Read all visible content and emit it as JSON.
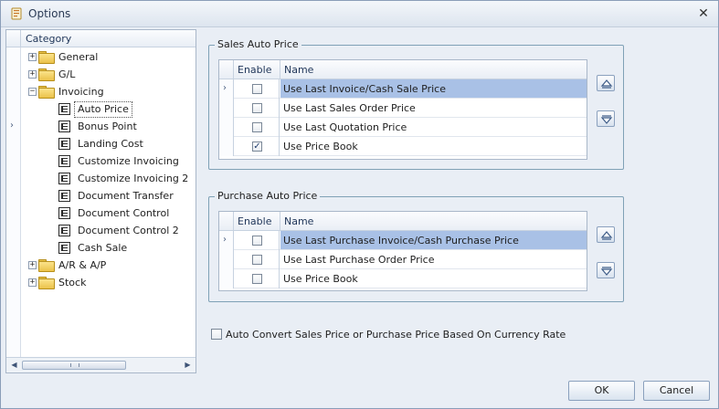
{
  "window": {
    "title": "Options",
    "close_glyph": "✕"
  },
  "tree": {
    "header": "Category",
    "items": [
      {
        "label": "General",
        "type": "folder",
        "level": 0,
        "expander": "+"
      },
      {
        "label": "G/L",
        "type": "folder",
        "level": 0,
        "expander": "+"
      },
      {
        "label": "Invoicing",
        "type": "folder",
        "level": 0,
        "expander": "−"
      },
      {
        "label": "Auto Price",
        "type": "page",
        "level": 1,
        "selected": true
      },
      {
        "label": "Bonus Point",
        "type": "page",
        "level": 1
      },
      {
        "label": "Landing Cost",
        "type": "page",
        "level": 1
      },
      {
        "label": "Customize Invoicing",
        "type": "page",
        "level": 1
      },
      {
        "label": "Customize Invoicing 2",
        "type": "page",
        "level": 1
      },
      {
        "label": "Document Transfer",
        "type": "page",
        "level": 1
      },
      {
        "label": "Document Control",
        "type": "page",
        "level": 1
      },
      {
        "label": "Document Control 2",
        "type": "page",
        "level": 1
      },
      {
        "label": "Cash Sale",
        "type": "page",
        "level": 1
      },
      {
        "label": "A/R & A/P",
        "type": "folder",
        "level": 0,
        "expander": "+"
      },
      {
        "label": "Stock",
        "type": "folder",
        "level": 0,
        "expander": "+"
      }
    ]
  },
  "sales_auto_price": {
    "title": "Sales Auto Price",
    "columns": {
      "enable": "Enable",
      "name": "Name"
    },
    "rows": [
      {
        "enabled": false,
        "name": "Use Last Invoice/Cash Sale Price",
        "selected": true
      },
      {
        "enabled": false,
        "name": "Use Last Sales Order Price"
      },
      {
        "enabled": false,
        "name": "Use Last Quotation Price"
      },
      {
        "enabled": true,
        "name": "Use Price Book"
      }
    ]
  },
  "purchase_auto_price": {
    "title": "Purchase Auto Price",
    "columns": {
      "enable": "Enable",
      "name": "Name"
    },
    "rows": [
      {
        "enabled": false,
        "name": "Use Last Purchase Invoice/Cash Purchase Price",
        "selected": true
      },
      {
        "enabled": false,
        "name": "Use Last Purchase Order Price"
      },
      {
        "enabled": false,
        "name": "Use Price Book"
      }
    ]
  },
  "auto_convert": {
    "label": "Auto Convert Sales Price or Purchase Price Based On Currency Rate",
    "checked": false
  },
  "buttons": {
    "ok": "OK",
    "cancel": "Cancel"
  },
  "glyphs": {
    "row_indicator": "›",
    "check": "✓"
  }
}
